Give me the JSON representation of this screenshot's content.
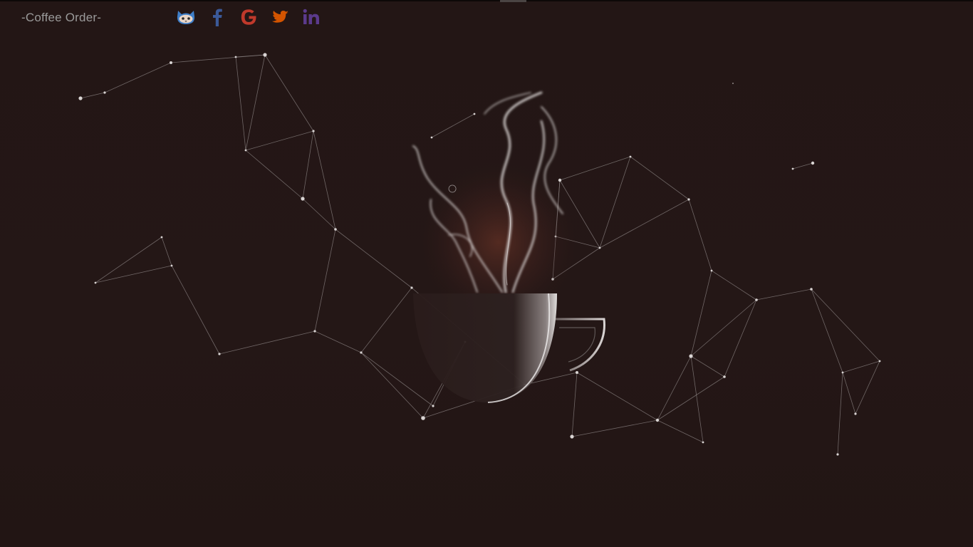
{
  "header": {
    "brand_label": "-Coffee Order-"
  },
  "social_links": [
    {
      "name": "github",
      "icon": "github-icon",
      "color": "#3f7fc9"
    },
    {
      "name": "facebook",
      "icon": "facebook-icon",
      "color": "#3b5998"
    },
    {
      "name": "google",
      "icon": "google-icon",
      "color": "#c0392b"
    },
    {
      "name": "twitter",
      "icon": "twitter-icon",
      "color": "#d35400"
    },
    {
      "name": "linkedin",
      "icon": "linkedin-icon",
      "color": "#5b3a8c"
    }
  ],
  "colors": {
    "background": "#231615",
    "network_line": "#8a8282",
    "network_dot": "#d9d4d3",
    "brand_text": "#9a9a9a"
  },
  "hero": {
    "image": "steaming-coffee-cup"
  }
}
